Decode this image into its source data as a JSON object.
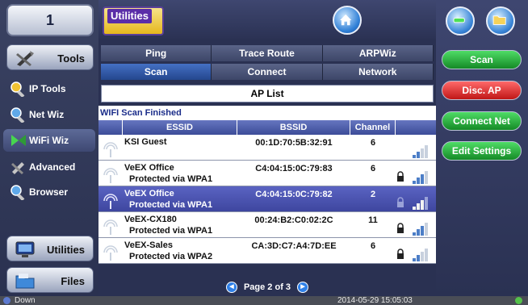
{
  "channel_box": {
    "value": "1"
  },
  "left_panel": {
    "tools_button": "Tools",
    "nav": [
      {
        "label": "IP Tools",
        "icon": "ip-tools-icon"
      },
      {
        "label": "Net Wiz",
        "icon": "net-wiz-icon"
      },
      {
        "label": "WiFi Wiz",
        "icon": "wifi-wiz-icon",
        "active": true
      },
      {
        "label": "Advanced",
        "icon": "advanced-icon"
      },
      {
        "label": "Browser",
        "icon": "browser-icon"
      }
    ],
    "utilities_button": "Utilities",
    "files_button": "Files"
  },
  "topbar": {
    "title": "Utilities"
  },
  "tabs_row1": [
    "Ping",
    "Trace Route",
    "ARPWiz"
  ],
  "tabs_row2": [
    "Scan",
    "Connect",
    "Network"
  ],
  "selected_tab": "Scan",
  "list_title": "AP List",
  "status": "WIFI Scan Finished",
  "columns": [
    "ESSID",
    "BSSID",
    "Channel"
  ],
  "access_points": [
    {
      "essid": "KSI Guest",
      "security": "",
      "bssid": "00:1D:70:5B:32:91",
      "channel": "6",
      "locked": false,
      "signal": 2
    },
    {
      "essid": "VeEX Office",
      "security": "Protected via WPA1",
      "bssid": "C4:04:15:0C:79:83",
      "channel": "6",
      "locked": true,
      "signal": 3
    },
    {
      "essid": "VeEX Office",
      "security": "Protected via WPA1",
      "bssid": "C4:04:15:0C:79:82",
      "channel": "2",
      "locked": true,
      "signal": 3,
      "selected": true
    },
    {
      "essid": "VeEX-CX180",
      "security": "Protected via WPA1",
      "bssid": "00:24:B2:C0:02:2C",
      "channel": "11",
      "locked": true,
      "signal": 3
    },
    {
      "essid": "VeEX-Sales",
      "security": "Protected via WPA2",
      "bssid": "CA:3D:C7:A4:7D:EE",
      "channel": "6",
      "locked": true,
      "signal": 2
    }
  ],
  "pager": {
    "label": "Page 2 of 3"
  },
  "right_panel": {
    "buttons": [
      {
        "label": "Scan",
        "color": "#1e9a33"
      },
      {
        "label": "Disc. AP",
        "color": "#d42020"
      },
      {
        "label": "Connect Net",
        "color": "#1e9a33"
      },
      {
        "label": "Edit Settings",
        "color": "#1e9a33"
      }
    ]
  },
  "status_strip": {
    "left": "Down",
    "datetime": "2014-05-29  15:05:03"
  }
}
